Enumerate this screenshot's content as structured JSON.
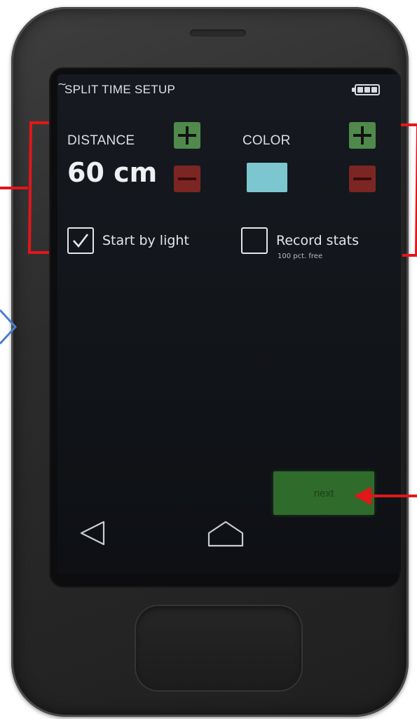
{
  "header": {
    "title": "SPLIT TIME SETUP",
    "battery_icon": "battery-full-icon"
  },
  "distance": {
    "label": "DISTANCE",
    "value": "60 cm",
    "increase_icon": "plus-icon",
    "decrease_icon": "minus-icon"
  },
  "color": {
    "label": "COLOR",
    "swatch_color": "#7cc6cf",
    "increase_icon": "plus-icon",
    "decrease_icon": "minus-icon"
  },
  "options": [
    {
      "label": "Start by light",
      "checked": true,
      "sublabel": ""
    },
    {
      "label": "Record stats",
      "checked": false,
      "sublabel": "100 pct. free"
    }
  ],
  "actions": {
    "next_label": "next"
  },
  "navigation": {
    "back_icon": "back-triangle-icon",
    "home_icon": "home-icon"
  },
  "colors": {
    "plus_button": "#4f8a4c",
    "minus_button": "#7c2623",
    "next_button": "#2f6b2a",
    "annotation_red": "#e3161b",
    "annotation_blue": "#4a7fd0"
  }
}
